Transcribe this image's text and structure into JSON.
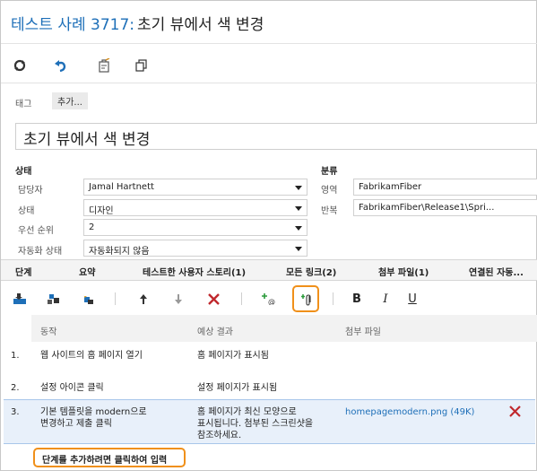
{
  "header": {
    "type_and_id": "테스트 사례 3717:",
    "title": "초기 뷰에서 색 변경"
  },
  "toolbar": {
    "icons": [
      "refresh-icon",
      "undo-icon",
      "clipboard-edit-icon",
      "copy-icon"
    ]
  },
  "tags": {
    "label": "태그",
    "add_label": "추가..."
  },
  "work_item_title": "초기 뷰에서 색 변경",
  "status_section": {
    "heading": "상태",
    "fields": [
      {
        "label": "담당자",
        "value": "Jamal Hartnett"
      },
      {
        "label": "상태",
        "value": "디자인"
      },
      {
        "label": "우선 순위",
        "value": "2"
      },
      {
        "label": "자동화 상태",
        "value": "자동화되지 않음"
      }
    ]
  },
  "classification_section": {
    "heading": "분류",
    "fields": [
      {
        "label": "영역",
        "value": "FabrikamFiber"
      },
      {
        "label": "반복",
        "value": "FabrikamFiber\\Release1\\Spri..."
      }
    ]
  },
  "tabs": [
    "단계",
    "요약",
    "테스트한 사용자 스토리(1)",
    "모든 링크(2)",
    "첨부 파일(1)",
    "연결된 자동..."
  ],
  "steps_toolbar": {
    "bold": "B",
    "italic": "I",
    "underline": "U"
  },
  "grid": {
    "columns": [
      "동작",
      "예상 결과",
      "첨부 파일"
    ],
    "rows": [
      {
        "num": "1.",
        "action": "웹 사이트의 홈 페이지 열기",
        "expected": "홈 페이지가 표시됨",
        "attachment": ""
      },
      {
        "num": "2.",
        "action": "설정 아이콘 클릭",
        "expected": "설정 페이지가 표시됨",
        "attachment": ""
      },
      {
        "num": "3.",
        "action": "기본 템플릿을 modern으로\n변경하고 제출 클릭",
        "expected": "홈 페이지가 최신 모양으로\n표시됩니다. 첨부된 스크린샷을\n참조하세요.",
        "attachment": "homepagemodern.png (49K)"
      }
    ],
    "add_step": "단계를 추가하려면 클릭하여 입력"
  },
  "colors": {
    "accent": "#1e6fb8",
    "highlight": "#f0901a",
    "delete": "#c0282d"
  }
}
